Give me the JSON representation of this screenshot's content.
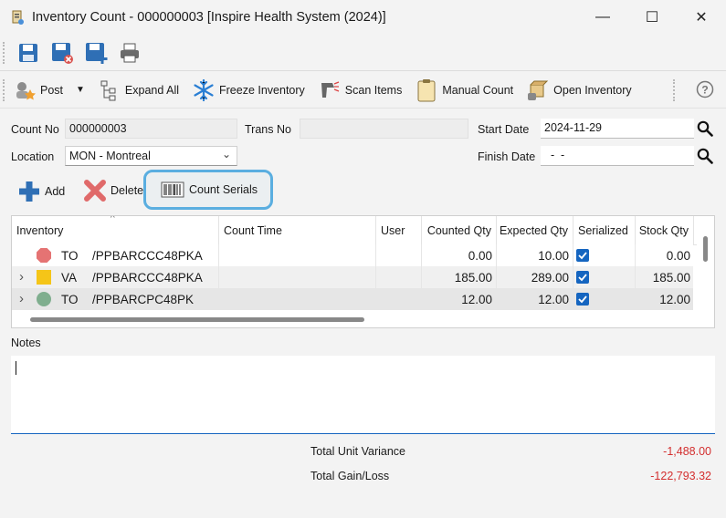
{
  "window": {
    "title": "Inventory Count - 000000003 [Inspire Health System (2024)]",
    "minimize": "—",
    "maximize": "☐",
    "close": "✕"
  },
  "quick_access": [
    "save-icon",
    "save-close-icon",
    "save-new-icon",
    "print-icon"
  ],
  "toolbar": {
    "post": "Post",
    "expand_all": "Expand All",
    "freeze_inventory": "Freeze Inventory",
    "scan_items": "Scan Items",
    "manual_count": "Manual Count",
    "open_inventory": "Open Inventory",
    "help": "?"
  },
  "form": {
    "count_no_label": "Count No",
    "count_no": "000000003",
    "trans_no_label": "Trans No",
    "trans_no": "",
    "start_date_label": "Start Date",
    "start_date": "2024-11-29",
    "location_label": "Location",
    "location": "MON - Montreal",
    "finish_date_label": "Finish Date",
    "finish_date": "  -  -"
  },
  "actions": {
    "add": "Add",
    "delete": "Delete",
    "count_serials": "Count Serials"
  },
  "grid": {
    "columns": [
      "Inventory",
      "Count Time",
      "User",
      "Counted Qty",
      "Expected Qty",
      "Serialized",
      "Stock Qty"
    ],
    "rows": [
      {
        "expand": "",
        "marker": "red-octagon",
        "wh": "TO",
        "item": "/PPBARCCC48PKA",
        "count_time": "",
        "user": "",
        "counted": "0.00",
        "expected": "10.00",
        "serialized": true,
        "stock": "0.00"
      },
      {
        "expand": "›",
        "marker": "yellow-square",
        "wh": "VA",
        "item": "/PPBARCCC48PKA",
        "count_time": "",
        "user": "",
        "counted": "185.00",
        "expected": "289.00",
        "serialized": true,
        "stock": "185.00"
      },
      {
        "expand": "›",
        "marker": "green-circle",
        "wh": "TO",
        "item": "/PPBARCPC48PK",
        "count_time": "",
        "user": "",
        "counted": "12.00",
        "expected": "12.00",
        "serialized": true,
        "stock": "12.00"
      }
    ]
  },
  "notes": {
    "label": "Notes",
    "value": ""
  },
  "totals": {
    "unit_variance_label": "Total Unit Variance",
    "unit_variance": "-1,488.00",
    "gain_loss_label": "Total Gain/Loss",
    "gain_loss": "-122,793.32"
  },
  "colors": {
    "accent": "#1565c0",
    "negative": "#d32f2f",
    "highlight": "#5aaee0"
  }
}
